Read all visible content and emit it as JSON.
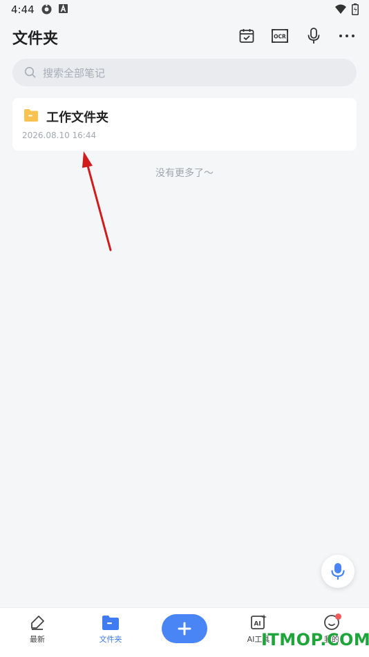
{
  "status_bar": {
    "time": "4:44"
  },
  "header": {
    "title": "文件夹"
  },
  "search": {
    "placeholder": "搜索全部笔记"
  },
  "folders": [
    {
      "name": "工作文件夹",
      "timestamp": "2026.08.10 16:44"
    }
  ],
  "list_end_text": "没有更多了～",
  "tabs": [
    {
      "label": "最新",
      "icon": "edit-icon"
    },
    {
      "label": "文件夹",
      "icon": "folder-icon",
      "active": true
    },
    {
      "label": "AI工具",
      "icon": "ai-icon"
    },
    {
      "label": "我的",
      "icon": "smile-icon"
    }
  ],
  "watermark": "ITMOP.COM",
  "colors": {
    "accent": "#4a85f6",
    "folder": "#f7c24f",
    "annotation_arrow": "#d01c1c"
  }
}
